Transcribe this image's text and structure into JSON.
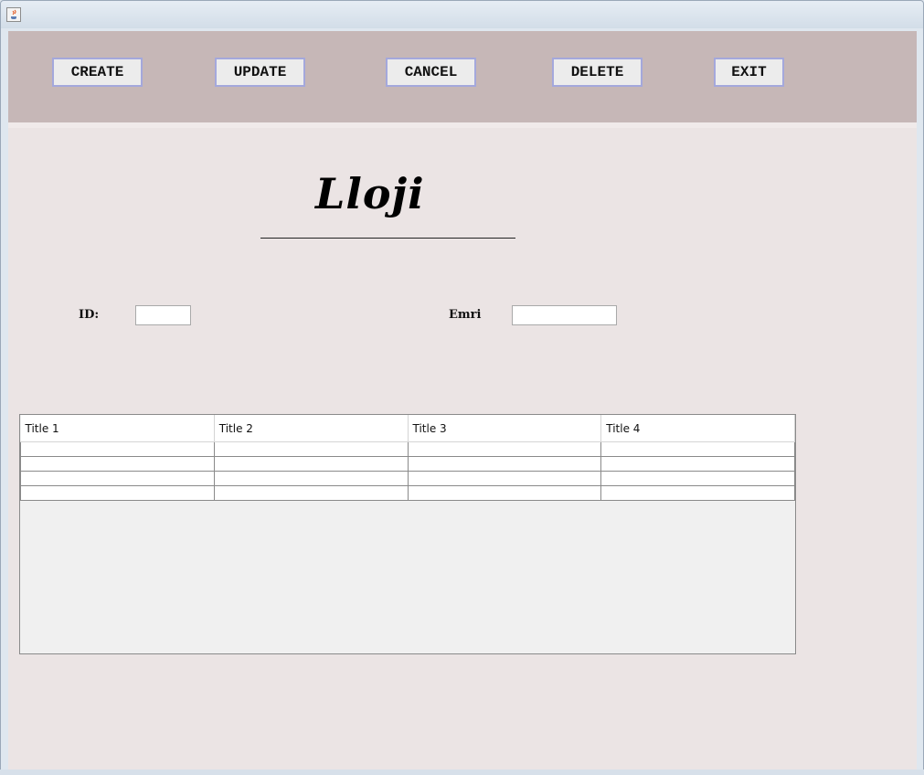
{
  "window": {
    "icon": "java-coffee-icon"
  },
  "toolbar": {
    "buttons": [
      {
        "label": "CREATE"
      },
      {
        "label": "UPDATE"
      },
      {
        "label": "CANCEL"
      },
      {
        "label": "DELETE"
      },
      {
        "label": "EXIT"
      }
    ]
  },
  "form": {
    "heading": "Lloji",
    "id_label": "ID:",
    "id_value": "",
    "emri_label": "Emri",
    "emri_value": ""
  },
  "table": {
    "columns": [
      "Title 1",
      "Title 2",
      "Title 3",
      "Title 4"
    ],
    "rows": [
      [
        "",
        "",
        "",
        ""
      ],
      [
        "",
        "",
        "",
        ""
      ],
      [
        "",
        "",
        "",
        ""
      ],
      [
        "",
        "",
        "",
        ""
      ]
    ]
  },
  "colors": {
    "toolbar_bg": "#c6b7b7",
    "panel_bg": "#ebe4e4",
    "button_border": "#a4a8dc"
  }
}
